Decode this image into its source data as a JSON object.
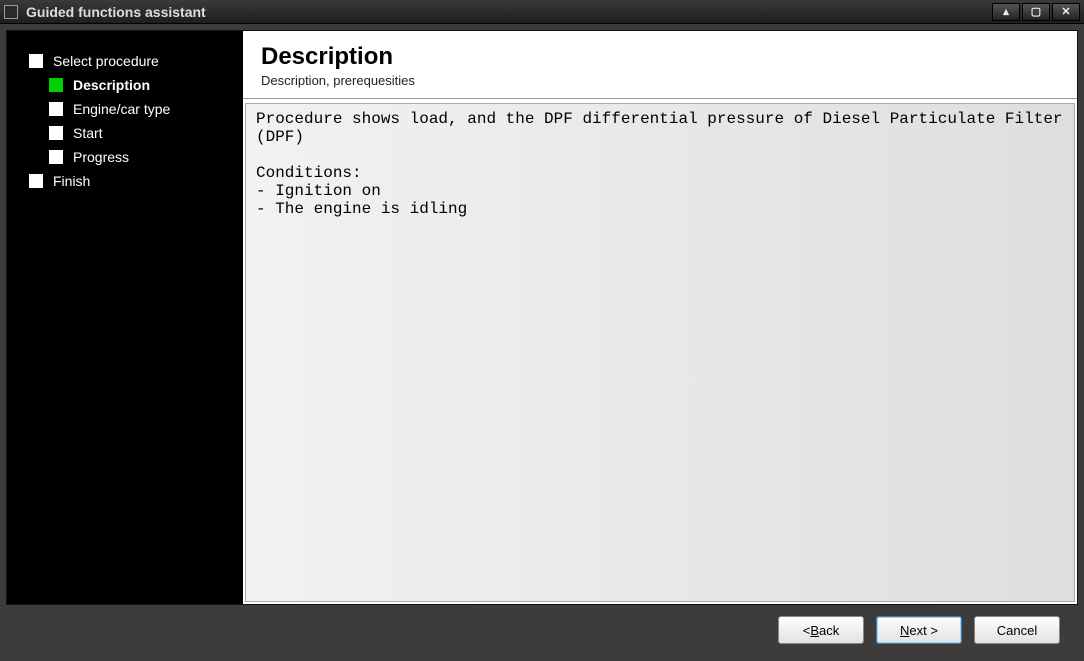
{
  "window": {
    "title": "Guided functions assistant"
  },
  "sidebar": {
    "steps": [
      {
        "label": "Select procedure",
        "indent": 0,
        "active": false
      },
      {
        "label": "Description",
        "indent": 1,
        "active": true
      },
      {
        "label": "Engine/car type",
        "indent": 1,
        "active": false
      },
      {
        "label": "Start",
        "indent": 1,
        "active": false
      },
      {
        "label": "Progress",
        "indent": 1,
        "active": false
      },
      {
        "label": "Finish",
        "indent": 0,
        "active": false
      }
    ]
  },
  "content": {
    "heading": "Description",
    "subheading": "Description, prerequesities",
    "body": "Procedure shows load, and the DPF differential pressure of Diesel Particulate Filter (DPF)\n\nConditions:\n- Ignition on\n- The engine is idling"
  },
  "footer": {
    "back": "< Back",
    "next": "Next >",
    "cancel": "Cancel"
  }
}
